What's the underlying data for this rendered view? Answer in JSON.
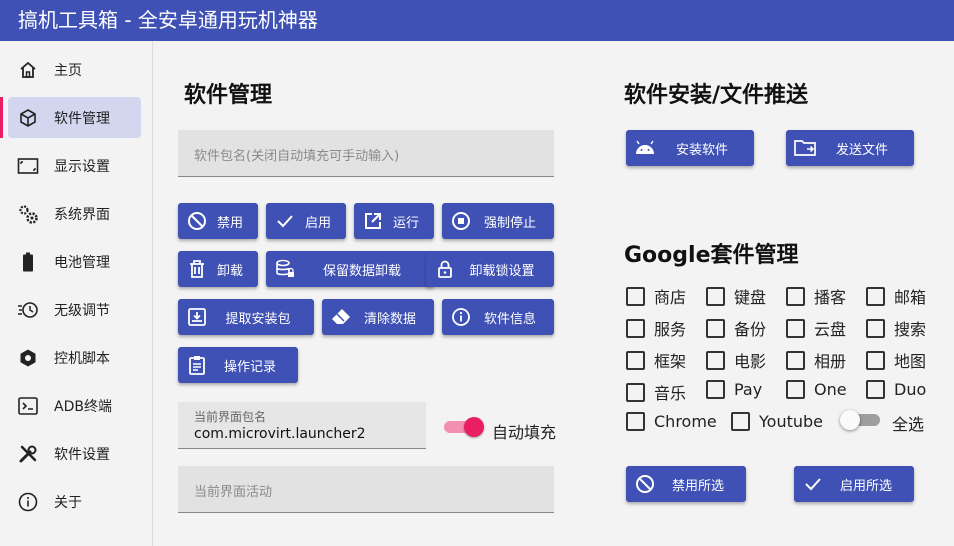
{
  "window": {
    "title": "搞机工具箱 - 全安卓通用玩机神器"
  },
  "sidebar": {
    "items": [
      {
        "label": "主页",
        "icon": "home-icon"
      },
      {
        "label": "软件管理",
        "icon": "cube-icon",
        "active": true
      },
      {
        "label": "显示设置",
        "icon": "screen-icon"
      },
      {
        "label": "系统界面",
        "icon": "gears-icon"
      },
      {
        "label": "电池管理",
        "icon": "battery-icon"
      },
      {
        "label": "无级调节",
        "icon": "clock-icon"
      },
      {
        "label": "控机脚本",
        "icon": "hexagon-icon"
      },
      {
        "label": "ADB终端",
        "icon": "terminal-icon"
      },
      {
        "label": "软件设置",
        "icon": "tools-icon"
      },
      {
        "label": "关于",
        "icon": "info-icon"
      }
    ]
  },
  "app_mgmt": {
    "title": "软件管理",
    "package_placeholder": "软件包名(关闭自动填充可手动输入)",
    "buttons": {
      "disable": "禁用",
      "enable": "启用",
      "run": "运行",
      "force_stop": "强制停止",
      "uninstall": "卸载",
      "keep_data_uninstall": "保留数据卸载",
      "uninstall_lock": "卸载锁设置",
      "extract_apk": "提取安装包",
      "clear_data": "清除数据",
      "app_info": "软件信息",
      "op_log": "操作记录"
    },
    "current_package_label": "当前界面包名",
    "current_package_value": "com.microvirt.launcher2",
    "autofill_label": "自动填充",
    "autofill_on": true,
    "current_activity_placeholder": "当前界面活动"
  },
  "install": {
    "title": "软件安装/文件推送",
    "install_button": "安装软件",
    "send_button": "发送文件"
  },
  "google": {
    "title": "Google套件管理",
    "checkboxes": [
      "商店",
      "键盘",
      "播客",
      "邮箱",
      "服务",
      "备份",
      "云盘",
      "搜索",
      "框架",
      "电影",
      "相册",
      "地图",
      "音乐",
      "Pay",
      "One",
      "Duo",
      "Chrome",
      "Youtube"
    ],
    "select_all_label": "全选",
    "select_all_on": false,
    "disable_selected": "禁用所选",
    "enable_selected": "启用所选"
  },
  "colors": {
    "primary": "#3f51b5",
    "accent": "#e91e63",
    "nav_active_bg": "#d2d6ee",
    "field_bg": "#e2e2e2"
  }
}
